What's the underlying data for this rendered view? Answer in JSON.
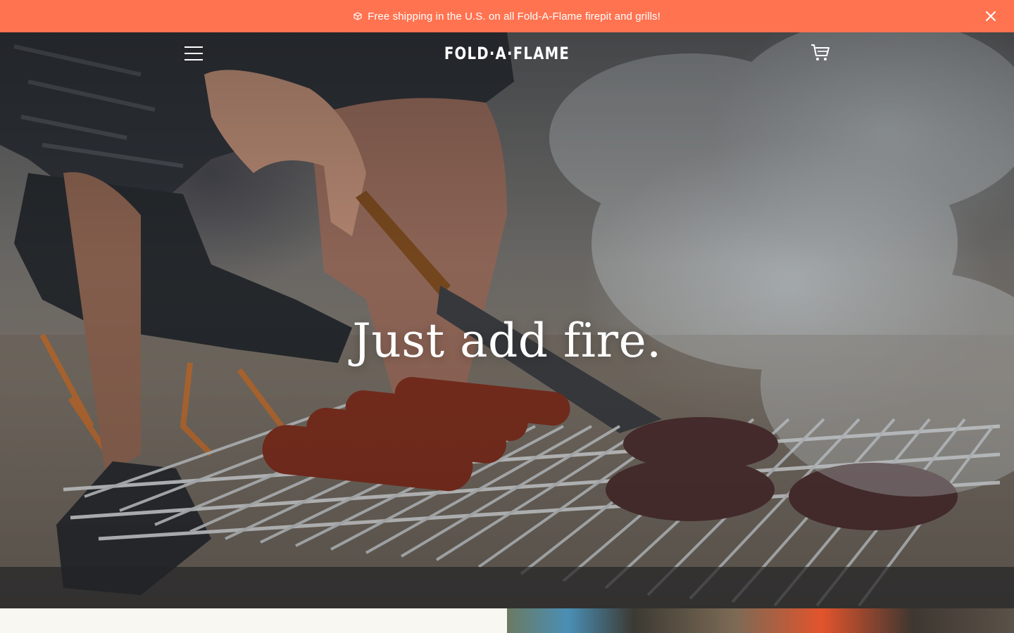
{
  "announcement": {
    "text": "Free shipping in the U.S. on all Fold-A-Flame firepit and grills!",
    "icon": "box-icon",
    "close_icon": "close-icon",
    "background": "#ff7350"
  },
  "header": {
    "menu_icon": "hamburger-menu-icon",
    "logo": "FOLD·A·FLAME",
    "cart_icon": "cart-icon"
  },
  "hero": {
    "headline": "Just add fire."
  }
}
